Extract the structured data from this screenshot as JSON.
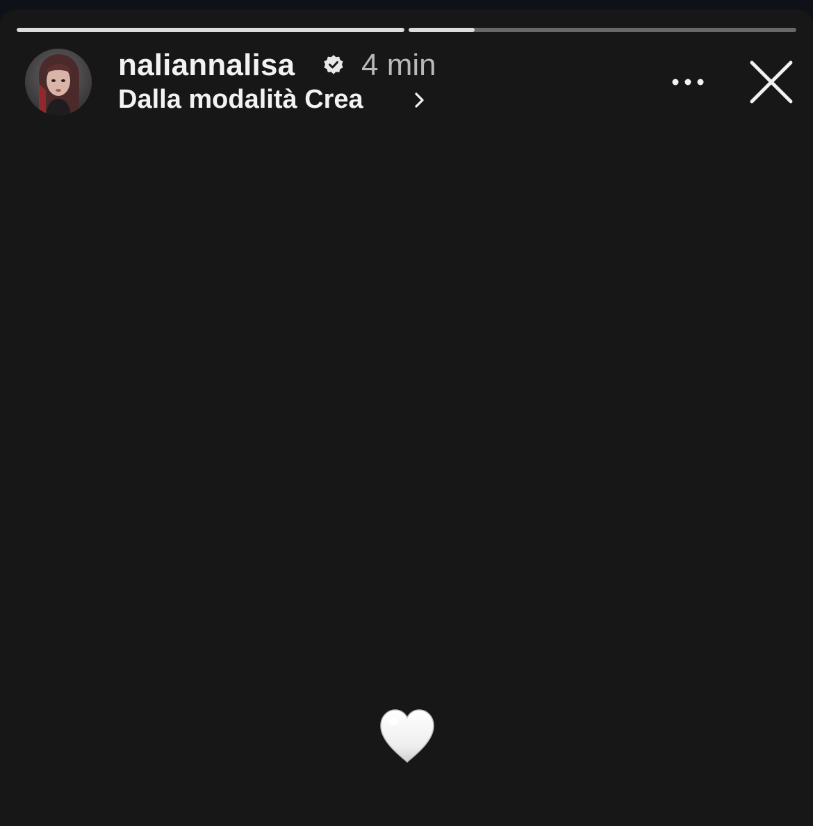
{
  "story": {
    "progress": [
      1.0,
      0.17
    ],
    "author": {
      "username": "naliannalisa",
      "verified": true,
      "avatar_icon": "profile-photo"
    },
    "time_ago": "4 min",
    "source_label": "Dalla modalità Crea",
    "content": {
      "emoji": "white-heart"
    }
  },
  "icons": {
    "verified": "verified-badge-icon",
    "chevron": "chevron-right-icon",
    "more": "more-options-icon",
    "close": "close-icon"
  },
  "colors": {
    "background": "#171717",
    "text": "#f2f2f2",
    "muted": "#b9b9b9"
  }
}
